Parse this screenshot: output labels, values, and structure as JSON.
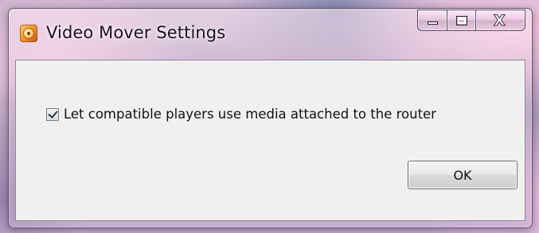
{
  "window": {
    "title": "Video Mover Settings",
    "app_icon": "video-mover-app-icon",
    "caption_buttons": {
      "minimize_icon": "minimize-icon",
      "maximize_icon": "maximize-icon",
      "close_icon": "close-icon",
      "close_glyph": "X"
    }
  },
  "settings": {
    "share_media_checkbox": {
      "label": "Let compatible players use media attached to the router",
      "checked": true
    },
    "ok_label": "OK"
  },
  "colors": {
    "client_background": "#f0f0f0",
    "title_text": "#1b1020"
  }
}
